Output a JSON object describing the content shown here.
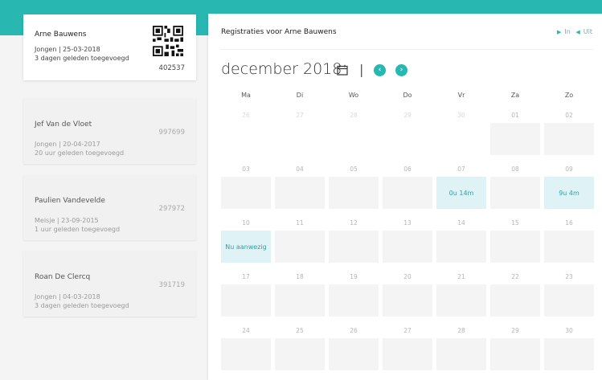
{
  "children": [
    {
      "name": "Arne Bauwens",
      "meta": "Jongen | 25-03-2018",
      "added": "3 dagen geleden toegevoegd",
      "code": "402537",
      "active": true
    },
    {
      "name": "Jef Van de Vloet",
      "meta": "Jongen | 20-04-2017",
      "added": "20 uur geleden toegevoegd",
      "code": "997699",
      "active": false
    },
    {
      "name": "Paulien Vandevelde",
      "meta": "Meisje | 23-09-2015",
      "added": "1 uur geleden toegevoegd",
      "code": "297972",
      "active": false
    },
    {
      "name": "Roan De Clercq",
      "meta": "Jongen | 04-03-2018",
      "added": "3 dagen geleden toegevoegd",
      "code": "391719",
      "active": false
    }
  ],
  "main": {
    "title": "Registraties voor Arne Bauwens",
    "in_label": "In",
    "out_label": "Uit",
    "month": "december 2018",
    "separator": "|",
    "prev_glyph": "‹",
    "next_glyph": "›"
  },
  "calendar": {
    "weekdays": [
      "Ma",
      "Di",
      "Wo",
      "Do",
      "Vr",
      "Za",
      "Zo"
    ],
    "weeks": [
      [
        {
          "d": "26",
          "m": true
        },
        {
          "d": "27",
          "m": true
        },
        {
          "d": "28",
          "m": true
        },
        {
          "d": "29",
          "m": true
        },
        {
          "d": "30",
          "m": true
        },
        {
          "d": "01"
        },
        {
          "d": "02"
        }
      ],
      [
        {
          "d": "03"
        },
        {
          "d": "04"
        },
        {
          "d": "05"
        },
        {
          "d": "06"
        },
        {
          "d": "07",
          "t": "0u 14m"
        },
        {
          "d": "08"
        },
        {
          "d": "09",
          "t": "9u 4m"
        }
      ],
      [
        {
          "d": "10",
          "t": "Nu aanwezig"
        },
        {
          "d": "11"
        },
        {
          "d": "12"
        },
        {
          "d": "13"
        },
        {
          "d": "14"
        },
        {
          "d": "15"
        },
        {
          "d": "16"
        }
      ],
      [
        {
          "d": "17"
        },
        {
          "d": "18"
        },
        {
          "d": "19"
        },
        {
          "d": "20"
        },
        {
          "d": "21"
        },
        {
          "d": "22"
        },
        {
          "d": "23"
        }
      ],
      [
        {
          "d": "24"
        },
        {
          "d": "25"
        },
        {
          "d": "26"
        },
        {
          "d": "27"
        },
        {
          "d": "28"
        },
        {
          "d": "29"
        },
        {
          "d": "30"
        }
      ]
    ]
  },
  "icons": {
    "calendar": "calendar-icon",
    "qr": "qr-code-icon",
    "prev": "chevron-left-icon",
    "next": "chevron-right-icon"
  },
  "colors": {
    "accent": "#29b7b2",
    "highlight": "#dff3f6"
  }
}
